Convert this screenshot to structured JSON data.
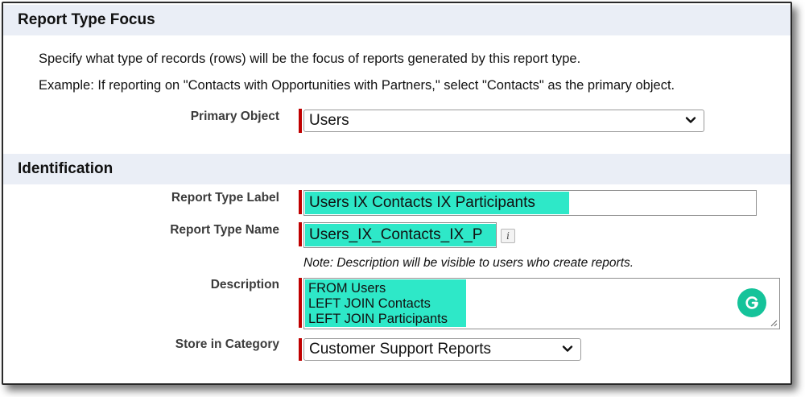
{
  "sections": {
    "focus_title": "Report Type Focus",
    "identification_title": "Identification"
  },
  "intro": {
    "line1": "Specify what type of records (rows) will be the focus of reports generated by this report type.",
    "line2": "Example: If reporting on \"Contacts with Opportunities with Partners,\" select \"Contacts\" as the primary object."
  },
  "primary_object": {
    "label": "Primary Object",
    "value": "Users"
  },
  "report_type_label": {
    "label": "Report Type Label",
    "value": "Users IX Contacts IX Participants"
  },
  "report_type_name": {
    "label": "Report Type Name",
    "value": "Users_IX_Contacts_IX_P",
    "info_icon": "i"
  },
  "description_note": "Note: Description will be visible to users who create reports.",
  "description": {
    "label": "Description",
    "lines": [
      "FROM Users",
      "LEFT JOIN Contacts",
      "LEFT JOIN Participants"
    ]
  },
  "store_in_category": {
    "label": "Store in Category",
    "value": "Customer Support Reports"
  },
  "colors": {
    "section_bg": "#eaeef6",
    "required_bar": "#c00000",
    "text_highlight": "#2ee8c8",
    "grammarly": "#15c39a"
  },
  "icons": [
    "chevron-down-icon",
    "info-icon",
    "grammarly-icon",
    "resize-grip-icon"
  ]
}
